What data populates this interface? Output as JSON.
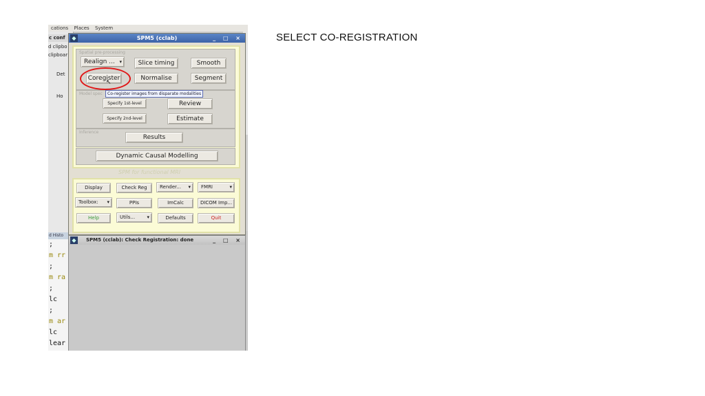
{
  "slide": {
    "title": "SELECT CO-REGISTRATION"
  },
  "desktop": {
    "menubar": [
      "cations",
      "Places",
      "System"
    ],
    "left_window": [
      "c conf",
      "d clipbo",
      "clipboar",
      "Det",
      "Ho"
    ],
    "console_header": "d Histo",
    "console_lines": [
      ";",
      "m rr",
      ";",
      "m ra",
      ";",
      "lc",
      ";",
      "m ar",
      "lc",
      "lear"
    ]
  },
  "spm_window": {
    "title": "SPM5 (cclab)",
    "title_controls": "_ □ ×",
    "spatial_label": "Spatial pre-processing",
    "realign_label": "Realign  ...",
    "slice_timing_label": "Slice timing",
    "smooth_label": "Smooth",
    "coregister_label": "Coregister",
    "normalise_label": "Normalise",
    "segment_label": "Segment",
    "tooltip": "Co-register images from disparate modalities",
    "model_label": "Model spec",
    "specify_1st_label": "Specify 1st-level",
    "review_label": "Review",
    "specify_2nd_label": "Specify 2nd-level",
    "estimate_label": "Estimate",
    "inference_label": "Inference",
    "results_label": "Results",
    "dcm_label": "Dynamic Causal Modelling",
    "footer_label": "SPM for functional MRI",
    "display_label": "Display",
    "check_reg_label": "Check Reg",
    "render_label": "Render...",
    "fmri_label": "FMRI",
    "toolbox_label": "Toolbox:",
    "ppis_label": "PPIs",
    "imcalc_label": "ImCalc",
    "dicom_label": "DICOM Imp...",
    "help_label": "Help",
    "utils_label": "Utils...",
    "defaults_label": "Defaults",
    "quit_label": "Quit"
  },
  "status_window": {
    "title": "SPM5 (cclab): Check Registration: done",
    "controls": "_ □ ×"
  },
  "colors": {
    "highlight": "#e01818",
    "pane": "#fbfbd6",
    "titlebar": "#4a74b8"
  }
}
